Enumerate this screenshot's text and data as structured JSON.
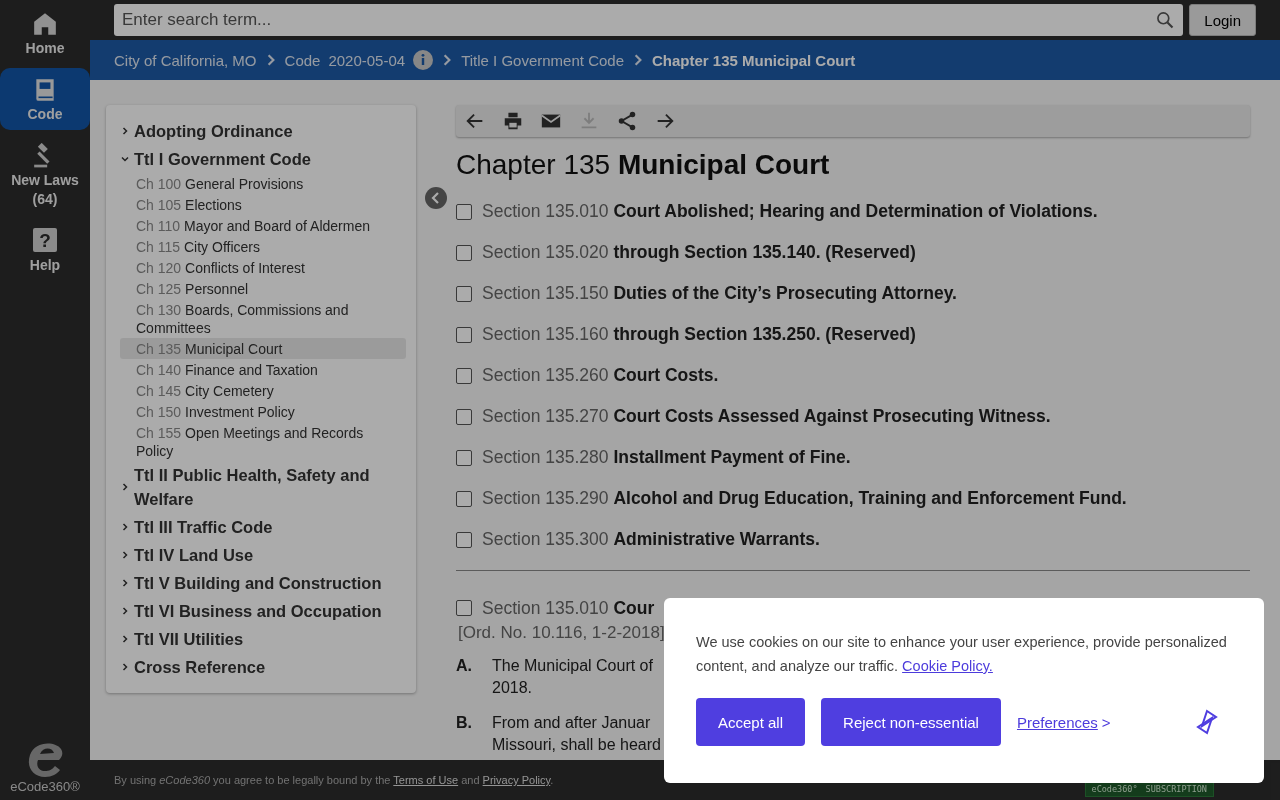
{
  "rail": {
    "items": [
      {
        "kind": "home",
        "label": "Home",
        "selected": false
      },
      {
        "kind": "code",
        "label": "Code",
        "selected": true
      },
      {
        "kind": "laws",
        "label": "New Laws",
        "count": "(64)",
        "selected": false
      },
      {
        "kind": "help",
        "label": "Help",
        "glyph": "?",
        "selected": false
      }
    ],
    "logo_text": "eCode360®"
  },
  "search": {
    "placeholder": "Enter search term...",
    "login": "Login"
  },
  "breadcrumb": [
    {
      "label": "City of California, MO",
      "current": false
    },
    {
      "label": "Code",
      "date": "2020-05-04",
      "current": false
    },
    {
      "label": "Title I Government Code",
      "current": false
    },
    {
      "label": "Chapter 135 Municipal Court",
      "current": true
    }
  ],
  "toc": [
    {
      "label": "Adopting Ordinance",
      "expanded": false
    },
    {
      "label": "Ttl I Government Code",
      "expanded": true,
      "children": [
        {
          "number": "Ch 100",
          "name": "General Provisions",
          "selected": false
        },
        {
          "number": "Ch 105",
          "name": "Elections",
          "selected": false
        },
        {
          "number": "Ch 110",
          "name": "Mayor and Board of Aldermen",
          "selected": false
        },
        {
          "number": "Ch 115",
          "name": "City Officers",
          "selected": false
        },
        {
          "number": "Ch 120",
          "name": "Conflicts of Interest",
          "selected": false
        },
        {
          "number": "Ch 125",
          "name": "Personnel",
          "selected": false
        },
        {
          "number": "Ch 130",
          "name": "Boards, Commissions and Committees",
          "selected": false
        },
        {
          "number": "Ch 135",
          "name": "Municipal Court",
          "selected": true
        },
        {
          "number": "Ch 140",
          "name": "Finance and Taxation",
          "selected": false
        },
        {
          "number": "Ch 145",
          "name": "City Cemetery",
          "selected": false
        },
        {
          "number": "Ch 150",
          "name": "Investment Policy",
          "selected": false
        },
        {
          "number": "Ch 155",
          "name": "Open Meetings and Records Policy",
          "selected": false
        }
      ]
    },
    {
      "label": "Ttl II Public Health, Safety and Welfare",
      "expanded": false
    },
    {
      "label": "Ttl III Traffic Code",
      "expanded": false
    },
    {
      "label": "Ttl IV Land Use",
      "expanded": false
    },
    {
      "label": "Ttl V Building and Construction",
      "expanded": false
    },
    {
      "label": "Ttl VI Business and Occupation",
      "expanded": false
    },
    {
      "label": "Ttl VII Utilities",
      "expanded": false
    },
    {
      "label": "Cross Reference",
      "expanded": false
    }
  ],
  "toolbar": [
    {
      "kind": "back",
      "disabled": false
    },
    {
      "kind": "print",
      "disabled": false
    },
    {
      "kind": "email",
      "disabled": false
    },
    {
      "kind": "download",
      "disabled": true
    },
    {
      "kind": "share",
      "disabled": false
    },
    {
      "kind": "forward",
      "disabled": false
    }
  ],
  "chapter": {
    "prefix": "Chapter 135",
    "name": "Municipal Court"
  },
  "sections": [
    {
      "number": "Section 135.010",
      "title": "Court Abolished; Hearing and Determination of Violations.",
      "checked": false
    },
    {
      "number": "Section 135.020",
      "title": "through Section 135.140. (Reserved)",
      "checked": false
    },
    {
      "number": "Section 135.150",
      "title": "Duties of the City’s Prosecuting Attorney.",
      "checked": false
    },
    {
      "number": "Section 135.160",
      "title": "through Section 135.250. (Reserved)",
      "checked": false
    },
    {
      "number": "Section 135.260",
      "title": "Court Costs.",
      "checked": false
    },
    {
      "number": "Section 135.270",
      "title": "Court Costs Assessed Against Prosecuting Witness.",
      "checked": false
    },
    {
      "number": "Section 135.280",
      "title": "Installment Payment of Fine.",
      "checked": false
    },
    {
      "number": "Section 135.290",
      "title": "Alcohol and Drug Education, Training and Enforcement Fund.",
      "checked": false
    },
    {
      "number": "Section 135.300",
      "title": "Administrative Warrants.",
      "checked": false
    }
  ],
  "detail": {
    "number": "Section 135.010",
    "title": "Cour",
    "checked": false,
    "history": "[Ord. No. 10.116, 1-2-2018]",
    "paragraphs": [
      {
        "label": "A.",
        "lines": [
          "The Municipal Court of",
          "2018."
        ]
      },
      {
        "label": "B.",
        "lines": [
          "From and after Januar",
          "Missouri, shall be heard"
        ]
      }
    ]
  },
  "footer": {
    "before": "By using *eCode360* you agree to be legally bound by the",
    "terms": "Terms of Use",
    "and": "and",
    "privacy": "Privacy Policy",
    "end": ".",
    "badge_brand": "eCode360°",
    "badge_label": "SUBSCRIPTION"
  },
  "cookie": {
    "text": "We use cookies on our site to enhance your user experience, provide personalized content, and analyze our traffic.",
    "policy_link": "Cookie Policy.",
    "accept": "Accept all",
    "reject": "Reject non-essential",
    "preferences": "Preferences",
    "preferences_arrow": ">"
  }
}
